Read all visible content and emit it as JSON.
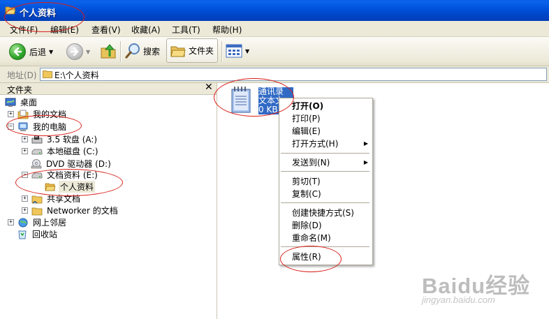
{
  "window": {
    "title": "个人资料"
  },
  "menubar": {
    "items": [
      {
        "label": "文件(F)"
      },
      {
        "label": "编辑(E)"
      },
      {
        "label": "查看(V)"
      },
      {
        "label": "收藏(A)"
      },
      {
        "label": "工具(T)"
      },
      {
        "label": "帮助(H)"
      }
    ]
  },
  "toolbar": {
    "back_label": "后退",
    "search_label": "搜索",
    "folders_label": "文件夹"
  },
  "address": {
    "label": "地址(D)",
    "value": "E:\\个人资料"
  },
  "folder_pane": {
    "title": "文件夹",
    "close_glyph": "✕",
    "tree": [
      {
        "label": "桌面"
      },
      {
        "label": "我的文档"
      },
      {
        "label": "我的电脑"
      },
      {
        "label": "3.5 软盘 (A:)"
      },
      {
        "label": "本地磁盘 (C:)"
      },
      {
        "label": "DVD 驱动器 (D:)"
      },
      {
        "label": "文档资料 (E:)"
      },
      {
        "label": "个人资料"
      },
      {
        "label": "共享文档"
      },
      {
        "label": "Networker 的文档"
      },
      {
        "label": "网上邻居"
      },
      {
        "label": "回收站"
      }
    ]
  },
  "content": {
    "file": {
      "label": "通讯录\n文本文\n0 KB"
    }
  },
  "context_menu": {
    "items": [
      {
        "label": "打开(O)"
      },
      {
        "label": "打印(P)"
      },
      {
        "label": "编辑(E)"
      },
      {
        "label": "打开方式(H)"
      },
      {
        "label": "发送到(N)"
      },
      {
        "label": "剪切(T)"
      },
      {
        "label": "复制(C)"
      },
      {
        "label": "创建快捷方式(S)"
      },
      {
        "label": "删除(D)"
      },
      {
        "label": "重命名(M)"
      },
      {
        "label": "属性(R)"
      }
    ]
  },
  "watermark": {
    "logo": "Baidu经验",
    "url": "jingyan.baidu.com"
  },
  "colors": {
    "titlebar": "#0050d8",
    "chrome": "#ece9d8",
    "selection": "#316ac5",
    "annotation": "#d91e18"
  }
}
